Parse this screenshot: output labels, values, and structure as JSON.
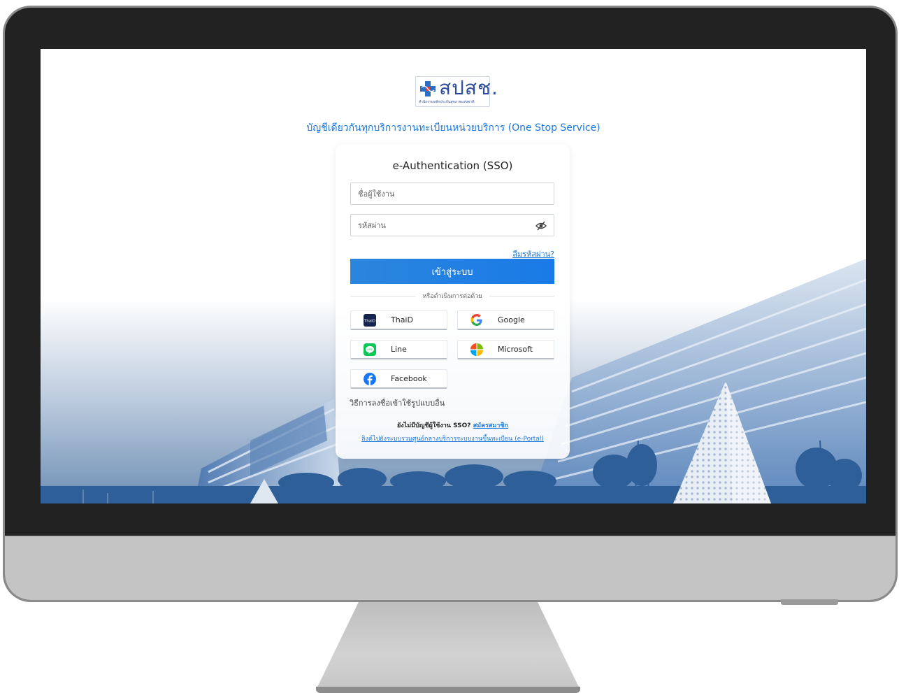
{
  "logo": {
    "text": "สปสช.",
    "subtitle": "สำนักงานหลักประกันสุขภาพแห่งชาติ"
  },
  "tagline": "บัญชีเดียวกันทุกบริการงานทะเบียนหน่วยบริการ (One Stop Service)",
  "login": {
    "title": "e-Authentication (SSO)",
    "username_placeholder": "ชื่อผู้ใช้งาน",
    "password_placeholder": "รหัสผ่าน",
    "forgot_password": "ลืมรหัสผ่าน?",
    "submit_label": "เข้าสู่ระบบ",
    "divider_text": "หรือดำเนินการต่อด้วย"
  },
  "social_logins": [
    {
      "label": "ThaiD",
      "icon": "thaid-icon"
    },
    {
      "label": "Google",
      "icon": "google-icon"
    },
    {
      "label": "Line",
      "icon": "line-icon"
    },
    {
      "label": "Microsoft",
      "icon": "microsoft-icon"
    },
    {
      "label": "Facebook",
      "icon": "facebook-icon"
    }
  ],
  "footer": {
    "other_signin": "วิธีการลงชื่อเข้าใช้รูปแบบอื่น",
    "no_account_text": "ยังไม่มีบัญชีผู้ใช้งาน SSO?",
    "register_link": "สมัครสมาชิก",
    "portal_link": "ลิงค์ไปยังระบบรวมศูนย์กลางบริการระบบงานขึ้นทะเบียน (e-Portal)"
  },
  "colors": {
    "accent": "#1e78d8",
    "button": "#2a86dc",
    "logo_blue": "#2b4b9c",
    "monitor_bezel": "#222222",
    "monitor_chin": "#c4c4c4"
  }
}
